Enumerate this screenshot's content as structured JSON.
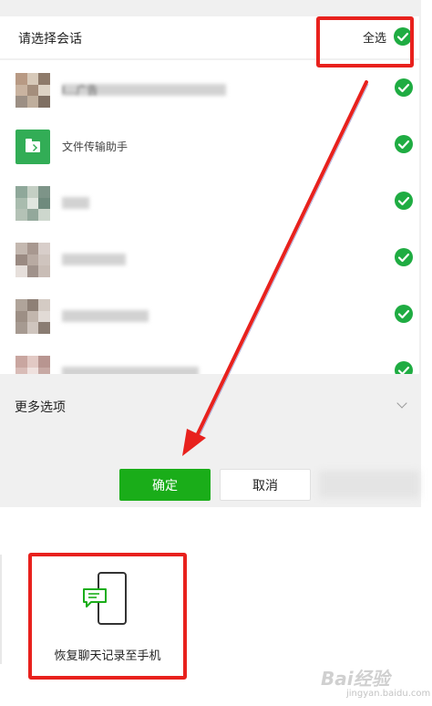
{
  "header": {
    "title": "请选择会话",
    "select_all_label": "全选"
  },
  "chats": [
    {
      "name": "I…广告",
      "avatar": "group-photo-collage",
      "blurred": true
    },
    {
      "name": "文件传输助手",
      "avatar": "file-transfer-icon",
      "blurred": false
    },
    {
      "name": "",
      "avatar": "group-photo-collage",
      "blurred": true
    },
    {
      "name": "",
      "avatar": "blurred-avatar",
      "blurred": true
    },
    {
      "name": "",
      "avatar": "blurred-avatar",
      "blurred": true
    },
    {
      "name": "",
      "avatar": "blurred-avatar",
      "blurred": true
    }
  ],
  "more_options_label": "更多选项",
  "buttons": {
    "confirm": "确定",
    "cancel": "取消"
  },
  "restore": {
    "label": "恢复聊天记录至手机"
  },
  "watermark": {
    "brand": "Bai经验",
    "url": "jingyan.baidu.com"
  },
  "colors": {
    "accent_green": "#1aad19",
    "check_green": "#1fac42",
    "annotation_red": "#e8211d"
  }
}
